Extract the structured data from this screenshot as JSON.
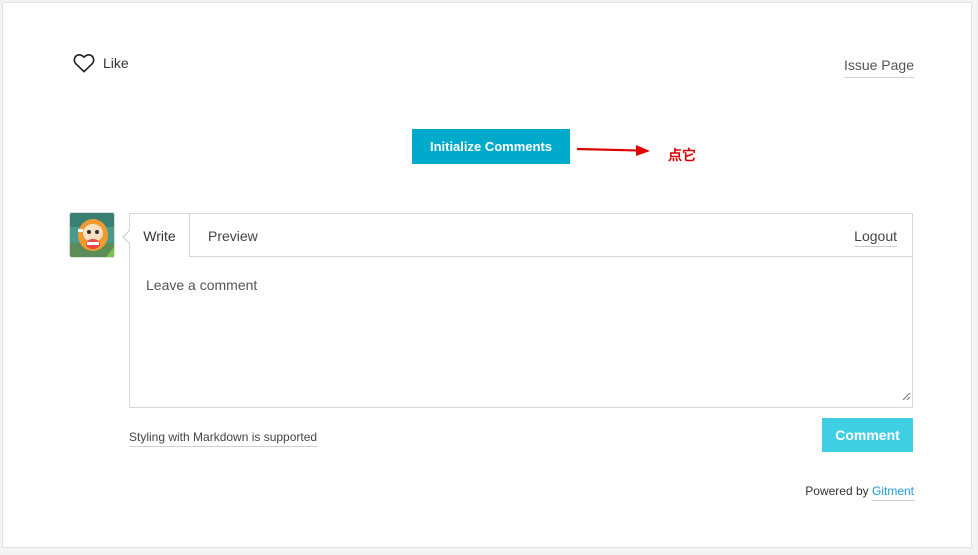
{
  "header": {
    "like_label": "Like",
    "issue_page_label": "Issue Page"
  },
  "init": {
    "button_label": "Initialize Comments"
  },
  "annotation": {
    "text": "点它",
    "color": "#e00000"
  },
  "editor": {
    "tabs": [
      "Write",
      "Preview"
    ],
    "logout_label": "Logout",
    "placeholder": "Leave a comment"
  },
  "footer": {
    "markdown_hint": "Styling with Markdown is supported",
    "comment_button_label": "Comment",
    "powered_by": "Powered by",
    "gitment_label": "Gitment"
  },
  "colors": {
    "accent": "#00aacb",
    "comment_button": "#3fcfe3",
    "link": "#1f98d6"
  },
  "icons": {
    "like": "heart-icon",
    "annotation": "red-arrow-icon",
    "avatar": "user-avatar"
  }
}
